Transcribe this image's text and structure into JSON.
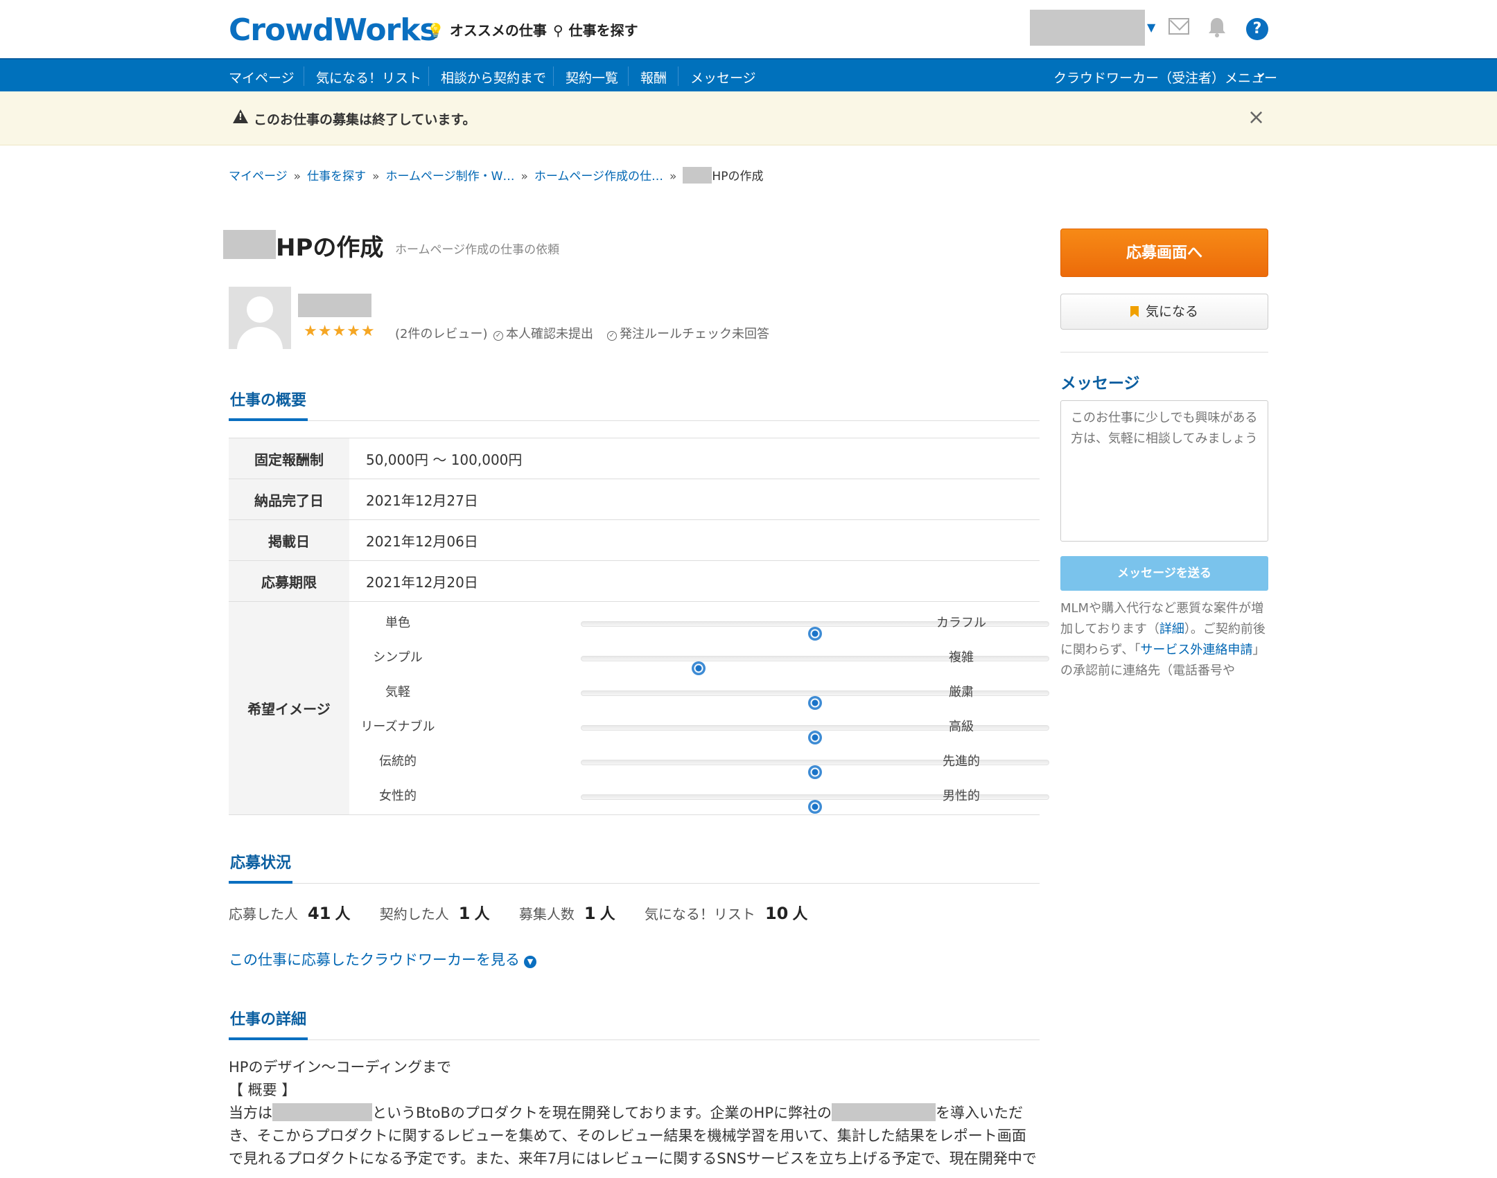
{
  "header": {
    "logo": "CrowdWorks",
    "nav_recommend": "オススメの仕事",
    "nav_search": "仕事を探す",
    "help": "?"
  },
  "gnav": {
    "items": [
      "マイページ",
      "気になる！リスト",
      "相談から契約まで",
      "契約一覧",
      "報酬",
      "メッセージ"
    ],
    "menu": "クラウドワーカー（受注者）メニュー"
  },
  "alert": {
    "text": "このお仕事の募集は終了しています。",
    "close": "×"
  },
  "breadcrumb": {
    "items": [
      "マイページ",
      "仕事を探す",
      "ホームページ制作・W…",
      "ホームページ作成の仕…"
    ],
    "sep": "»",
    "current": "HPの作成"
  },
  "job": {
    "title": "HPの作成",
    "subtitle": "ホームページ作成の仕事の依頼"
  },
  "client": {
    "stars": "★★★★★",
    "reviews": "(2件のレビュー)",
    "identity": "本人確認未提出",
    "rules": "発注ルールチェック未回答"
  },
  "overview": {
    "heading": "仕事の概要",
    "rows": [
      {
        "label": "固定報酬制",
        "value": "50,000円 〜 100,000円"
      },
      {
        "label": "納品完了日",
        "value": "2021年12月27日"
      },
      {
        "label": "掲載日",
        "value": "2021年12月06日"
      },
      {
        "label": "応募期限",
        "value": "2021年12月20日"
      }
    ],
    "image_label": "希望イメージ",
    "sliders": [
      {
        "left": "単色",
        "right": "カラフル",
        "value": 0.5
      },
      {
        "left": "シンプル",
        "right": "複雑",
        "value": 0.25
      },
      {
        "left": "気軽",
        "right": "厳粛",
        "value": 0.5
      },
      {
        "left": "リーズナブル",
        "right": "高級",
        "value": 0.5
      },
      {
        "left": "伝統的",
        "right": "先進的",
        "value": 0.5
      },
      {
        "left": "女性的",
        "right": "男性的",
        "value": 0.5
      }
    ]
  },
  "status": {
    "heading": "応募状況",
    "applied_label": "応募した人",
    "applied": "41",
    "contracted_label": "契約した人",
    "contracted": "1",
    "recruit_label": "募集人数",
    "recruit": "1",
    "fav_label": "気になる！リスト",
    "fav": "10",
    "unit": "人",
    "view_link": "この仕事に応募したクラウドワーカーを見る"
  },
  "detail": {
    "heading": "仕事の詳細",
    "line1": "HPのデザイン〜コーディングまで",
    "line2": "【 概要 】",
    "line3a": "当方は",
    "line3b": "というBtoBのプロダクトを現在開発しております。企業のHPに弊社の",
    "line3c": "を導入いただ",
    "line4": "き、そこからプロダクトに関するレビューを集めて、そのレビュー結果を機械学習を用いて、集計した結果をレポート画面",
    "line5": "で見れるプロダクトになる予定です。また、来年7月にはレビューに関するSNSサービスを立ち上げる予定で、現在開発中で"
  },
  "sidebar": {
    "apply": "応募画面へ",
    "favorite": "気になる",
    "message_heading": "メッセージ",
    "message_placeholder": "このお仕事に少しでも興味がある方は、気軽に相談してみましょう",
    "send": "メッセージを送る",
    "note_a": "MLMや購入代行など悪質な案件が増加しております（",
    "note_link1": "詳細",
    "note_b": "）。ご契約前後に関わらず、「",
    "note_link2": "サービス外連絡申請",
    "note_c": "」の承認前に連絡先（電話番号や"
  }
}
